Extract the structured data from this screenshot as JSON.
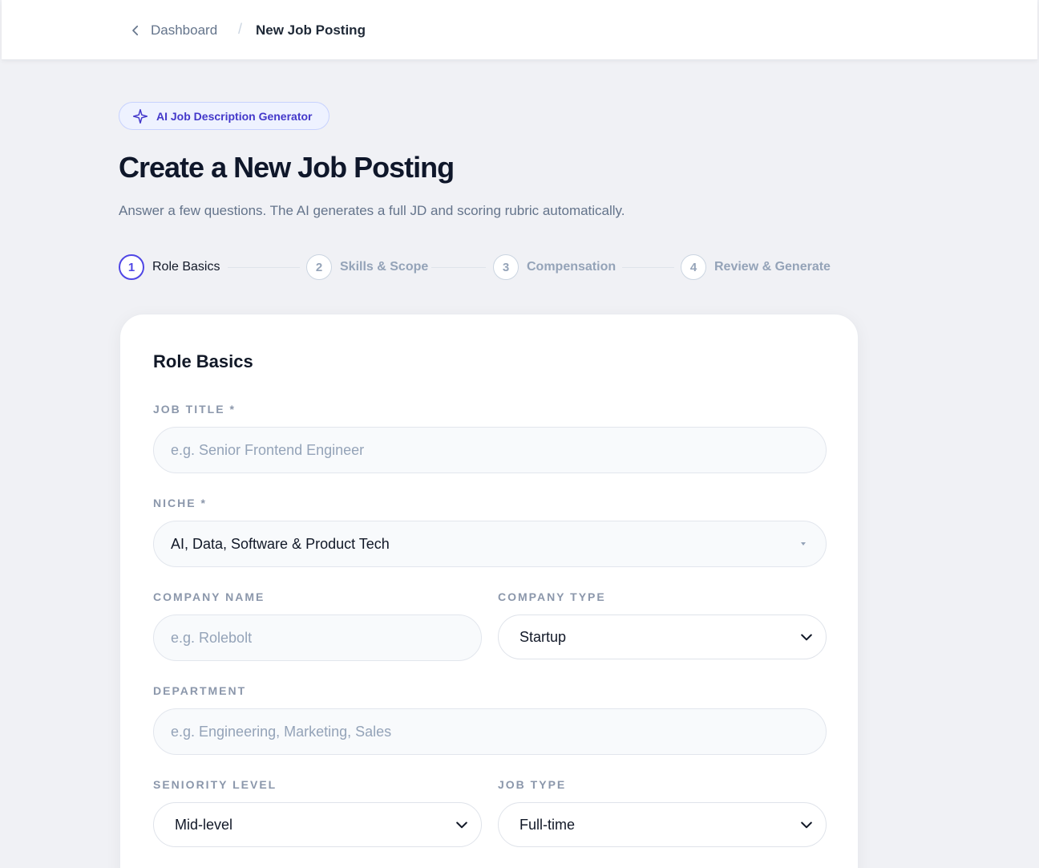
{
  "breadcrumb": {
    "back_label": "Dashboard",
    "separator": "/",
    "current": "New Job Posting"
  },
  "badge": {
    "label": "AI Job Description Generator",
    "icon": "sparkle-icon"
  },
  "header": {
    "title": "Create a New Job Posting",
    "subtitle": "Answer a few questions. The AI generates a full JD and scoring rubric automatically."
  },
  "steps": [
    {
      "number": "1",
      "label": "Role Basics",
      "active": true
    },
    {
      "number": "2",
      "label": "Skills & Scope",
      "active": false
    },
    {
      "number": "3",
      "label": "Compensation",
      "active": false
    },
    {
      "number": "4",
      "label": "Review & Generate",
      "active": false
    }
  ],
  "form": {
    "title": "Role Basics",
    "job_title": {
      "label": "JOB TITLE *",
      "placeholder": "e.g. Senior Frontend Engineer",
      "value": ""
    },
    "niche": {
      "label": "NICHE *",
      "value": "AI, Data, Software & Product Tech"
    },
    "company_name": {
      "label": "COMPANY NAME",
      "placeholder": "e.g. Rolebolt",
      "value": ""
    },
    "company_type": {
      "label": "COMPANY TYPE",
      "value": "Startup"
    },
    "department": {
      "label": "DEPARTMENT",
      "placeholder": "e.g. Engineering, Marketing, Sales",
      "value": ""
    },
    "seniority": {
      "label": "SENIORITY LEVEL",
      "value": "Mid-level"
    },
    "job_type": {
      "label": "JOB TYPE",
      "value": "Full-time"
    }
  },
  "colors": {
    "accent": "#4f46e5",
    "background": "#f0f1f5",
    "card": "#ffffff",
    "muted": "#94a3b8"
  }
}
